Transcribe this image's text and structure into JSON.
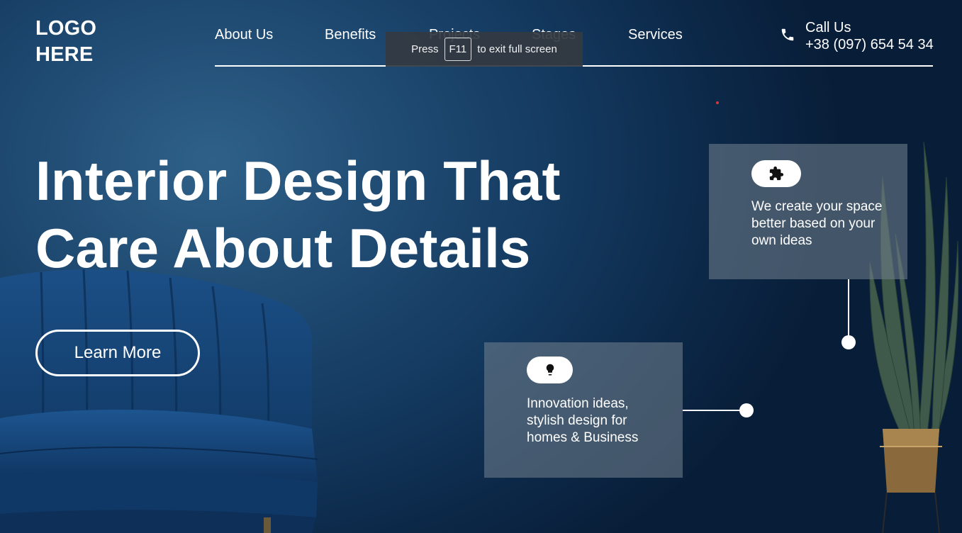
{
  "header": {
    "logo": "LOGO HERE",
    "nav": [
      {
        "label": "About Us"
      },
      {
        "label": "Benefits"
      },
      {
        "label": "Projects"
      },
      {
        "label": "Stages"
      },
      {
        "label": "Services"
      }
    ],
    "call_label": "Call Us",
    "call_number": "+38 (097) 654 54 34"
  },
  "fullscreen_notice": {
    "prefix": "Press",
    "key": "F11",
    "suffix": "to exit full screen"
  },
  "hero": {
    "title_line1": "Interior Design That",
    "title_line2": "Care About Details",
    "cta_label": "Learn More"
  },
  "cards": [
    {
      "icon": "puzzle-icon",
      "text": "We create your space better based on your own ideas"
    },
    {
      "icon": "lightbulb-icon",
      "text": "Innovation ideas, stylish design for homes & Business"
    }
  ],
  "colors": {
    "background_dark": "#0c2848",
    "background_light": "#2f6188",
    "text": "#ffffff",
    "card": "#6e7d8c"
  }
}
